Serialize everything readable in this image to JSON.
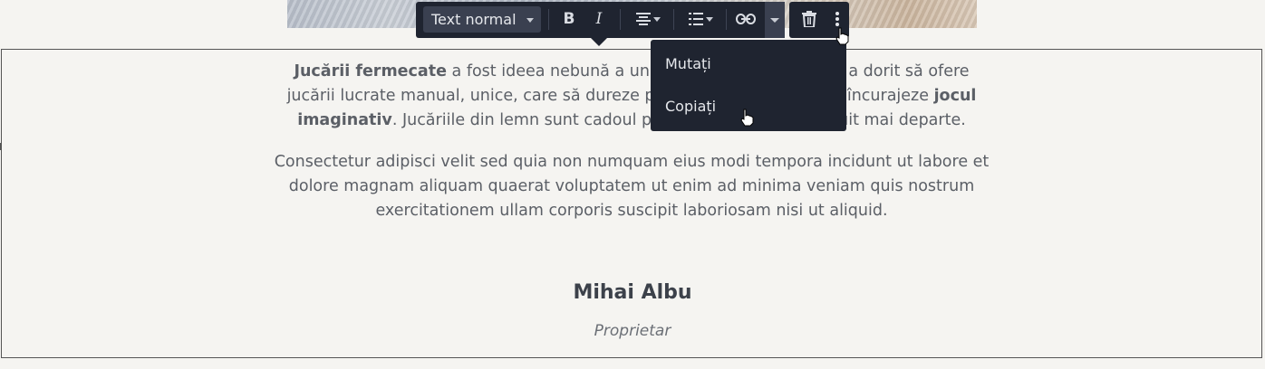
{
  "editor": {
    "paragraph1": {
      "part1_bold": "Jucării fermecate",
      "part2": " a fost ideea nebună a unu",
      "part3_hidden_gap": "",
      "line1_tail": "e a dorit să ofere",
      "line2_start": "jucării lucrate manual, unice, care să dureze p",
      "line2_tail": "ă încurajeze ",
      "line2_bold": "jocul",
      "line3_bold": "imaginativ",
      "line3_mid": ". Jucăriile din lemn sunt cadoul p",
      "line3_tail": "uit mai departe."
    },
    "paragraph2": "Consectetur adipisci velit sed quia non numquam eius modi tempora incidunt ut labore et dolore magnam aliquam quaerat voluptatem ut enim ad minima veniam quis nostrum exercitationem ullam corporis suscipit laboriosam nisi ut aliquid.",
    "author_name": "Mihai Albu",
    "author_role": "Proprietar"
  },
  "toolbar": {
    "text_style": "Text normal",
    "bold_label": "B",
    "italic_label": "I"
  },
  "context_menu": {
    "items": [
      "Mutați",
      "Copiați"
    ]
  },
  "colors": {
    "toolbar_bg": "#1f2430",
    "page_bg": "#f5f4f1",
    "text": "#5b5f66"
  }
}
